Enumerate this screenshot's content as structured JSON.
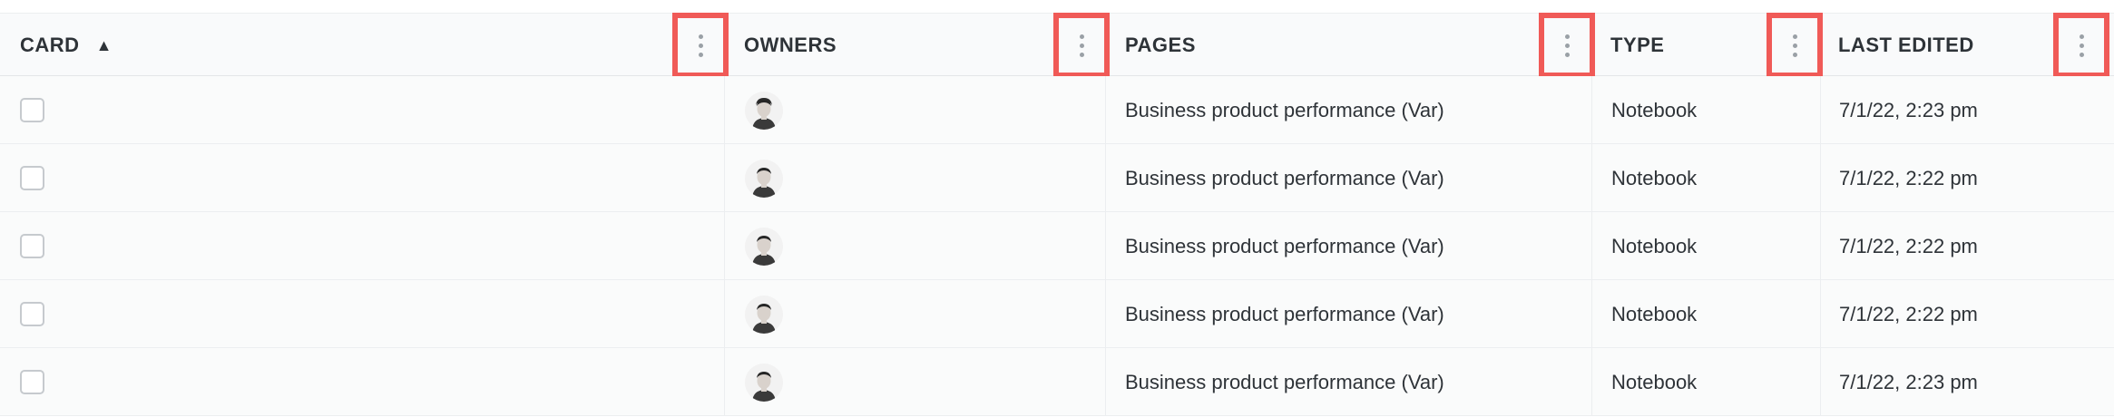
{
  "columns": {
    "card": {
      "label": "CARD",
      "sort_icon": "▲"
    },
    "owners": {
      "label": "OWNERS"
    },
    "pages": {
      "label": "PAGES"
    },
    "type": {
      "label": "TYPE"
    },
    "last_edited": {
      "label": "LAST EDITED"
    }
  },
  "rows": [
    {
      "page": "Business product performance (Var)",
      "type": "Notebook",
      "last_edited": "7/1/22, 2:23 pm"
    },
    {
      "page": "Business product performance (Var)",
      "type": "Notebook",
      "last_edited": "7/1/22, 2:22 pm"
    },
    {
      "page": "Business product performance (Var)",
      "type": "Notebook",
      "last_edited": "7/1/22, 2:22 pm"
    },
    {
      "page": "Business product performance (Var)",
      "type": "Notebook",
      "last_edited": "7/1/22, 2:22 pm"
    },
    {
      "page": "Business product performance (Var)",
      "type": "Notebook",
      "last_edited": "7/1/22, 2:23 pm"
    }
  ],
  "icons": {
    "column_menu": "kebab-menu-icon",
    "avatar": "owner-avatar"
  },
  "colors": {
    "highlight": "#f05a57",
    "header_bg": "#f9fafb",
    "text": "#2e3338"
  }
}
